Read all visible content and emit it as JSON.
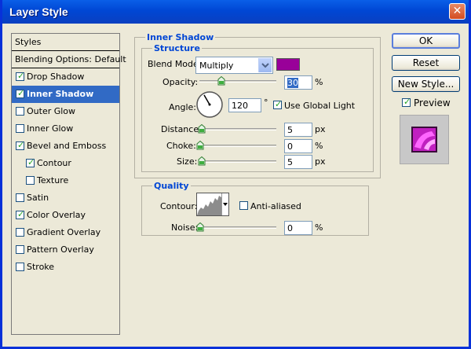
{
  "window": {
    "title": "Layer Style",
    "close_glyph": "✕"
  },
  "style_list": {
    "items": [
      {
        "label": "Styles",
        "checkbox": false,
        "checked": false,
        "indent": false,
        "selected": false
      },
      {
        "label": "Blending Options: Default",
        "checkbox": false,
        "checked": false,
        "indent": false,
        "selected": false
      },
      {
        "label": "Drop Shadow",
        "checkbox": true,
        "checked": true,
        "indent": false,
        "selected": false
      },
      {
        "label": "Inner Shadow",
        "checkbox": true,
        "checked": true,
        "indent": false,
        "selected": true
      },
      {
        "label": "Outer Glow",
        "checkbox": true,
        "checked": false,
        "indent": false,
        "selected": false
      },
      {
        "label": "Inner Glow",
        "checkbox": true,
        "checked": false,
        "indent": false,
        "selected": false
      },
      {
        "label": "Bevel and Emboss",
        "checkbox": true,
        "checked": true,
        "indent": false,
        "selected": false
      },
      {
        "label": "Contour",
        "checkbox": true,
        "checked": true,
        "indent": true,
        "selected": false
      },
      {
        "label": "Texture",
        "checkbox": true,
        "checked": false,
        "indent": true,
        "selected": false
      },
      {
        "label": "Satin",
        "checkbox": true,
        "checked": false,
        "indent": false,
        "selected": false
      },
      {
        "label": "Color Overlay",
        "checkbox": true,
        "checked": true,
        "indent": false,
        "selected": false
      },
      {
        "label": "Gradient Overlay",
        "checkbox": true,
        "checked": false,
        "indent": false,
        "selected": false
      },
      {
        "label": "Pattern Overlay",
        "checkbox": true,
        "checked": false,
        "indent": false,
        "selected": false
      },
      {
        "label": "Stroke",
        "checkbox": true,
        "checked": false,
        "indent": false,
        "selected": false
      }
    ]
  },
  "inner_shadow": {
    "title": "Inner Shadow",
    "structure": {
      "title": "Structure",
      "blend_mode_label": "Blend Mode:",
      "blend_mode_value": "Multiply",
      "shadow_color": "#990099",
      "opacity_label": "Opacity:",
      "opacity_value": "30",
      "opacity_unit": "%",
      "opacity_level": 0.3,
      "angle_label": "Angle:",
      "angle_value": "120",
      "angle_degrees": 120,
      "angle_unit": "°",
      "use_global_light_label": "Use Global Light",
      "use_global_light_checked": true,
      "distance_label": "Distance:",
      "distance_value": "5",
      "distance_unit": "px",
      "distance_level": 0.02,
      "choke_label": "Choke:",
      "choke_value": "0",
      "choke_unit": "%",
      "choke_level": 0,
      "size_label": "Size:",
      "size_value": "5",
      "size_unit": "px",
      "size_level": 0.02
    },
    "quality": {
      "title": "Quality",
      "contour_label": "Contour:",
      "anti_aliased_label": "Anti-aliased",
      "anti_aliased_checked": false,
      "noise_label": "Noise:",
      "noise_value": "0",
      "noise_unit": "%",
      "noise_level": 0
    }
  },
  "buttons": {
    "ok": "OK",
    "reset": "Reset",
    "new_style": "New Style...",
    "preview_label": "Preview",
    "preview_checked": true
  },
  "colors": {
    "accent": "#0046d5",
    "selection": "#316ac5",
    "swatch": "#990099"
  }
}
